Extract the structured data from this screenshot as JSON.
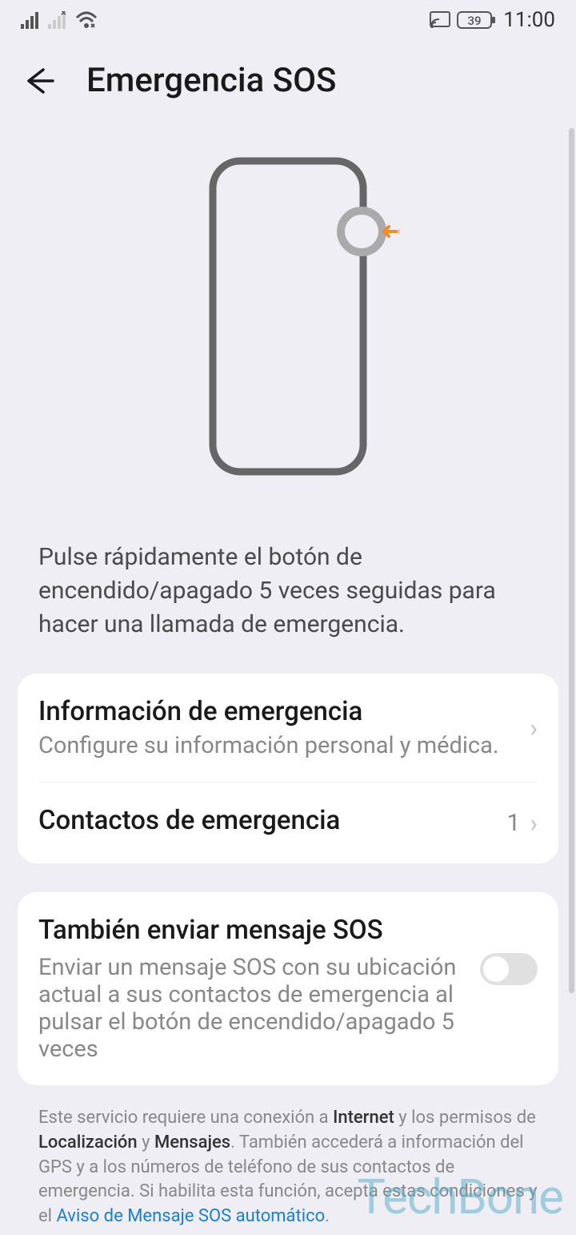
{
  "status_bar": {
    "battery_percent": "39",
    "time": "11:00"
  },
  "header": {
    "title": "Emergencia SOS"
  },
  "instruction": "Pulse rápidamente el botón de encendido/apagado 5 veces seguidas para hacer una llamada de emergencia.",
  "rows": {
    "emergency_info": {
      "title": "Información de emergencia",
      "subtitle": "Configure su información personal y médica."
    },
    "emergency_contacts": {
      "title": "Contactos de emergencia",
      "value": "1"
    },
    "sos_message": {
      "title": "También enviar mensaje SOS",
      "subtitle": "Enviar un mensaje SOS con su ubicación actual a sus contactos de emergencia al pulsar el botón de encendido/apagado 5 veces",
      "toggle": false
    }
  },
  "footer": {
    "text_parts": {
      "part1": "Este servicio requiere una conexión a ",
      "bold1": "Internet",
      "part2": " y los permisos de ",
      "bold2": "Localización",
      "part3": " y ",
      "bold3": "Mensajes",
      "part4": ". También accederá a información del GPS y a los números de teléfono de sus contactos de emergencia. Si habilita esta función, acepta estas condiciones y el ",
      "link": "Aviso de Mensaje SOS automático",
      "part5": "."
    }
  },
  "watermark": "TechBone"
}
